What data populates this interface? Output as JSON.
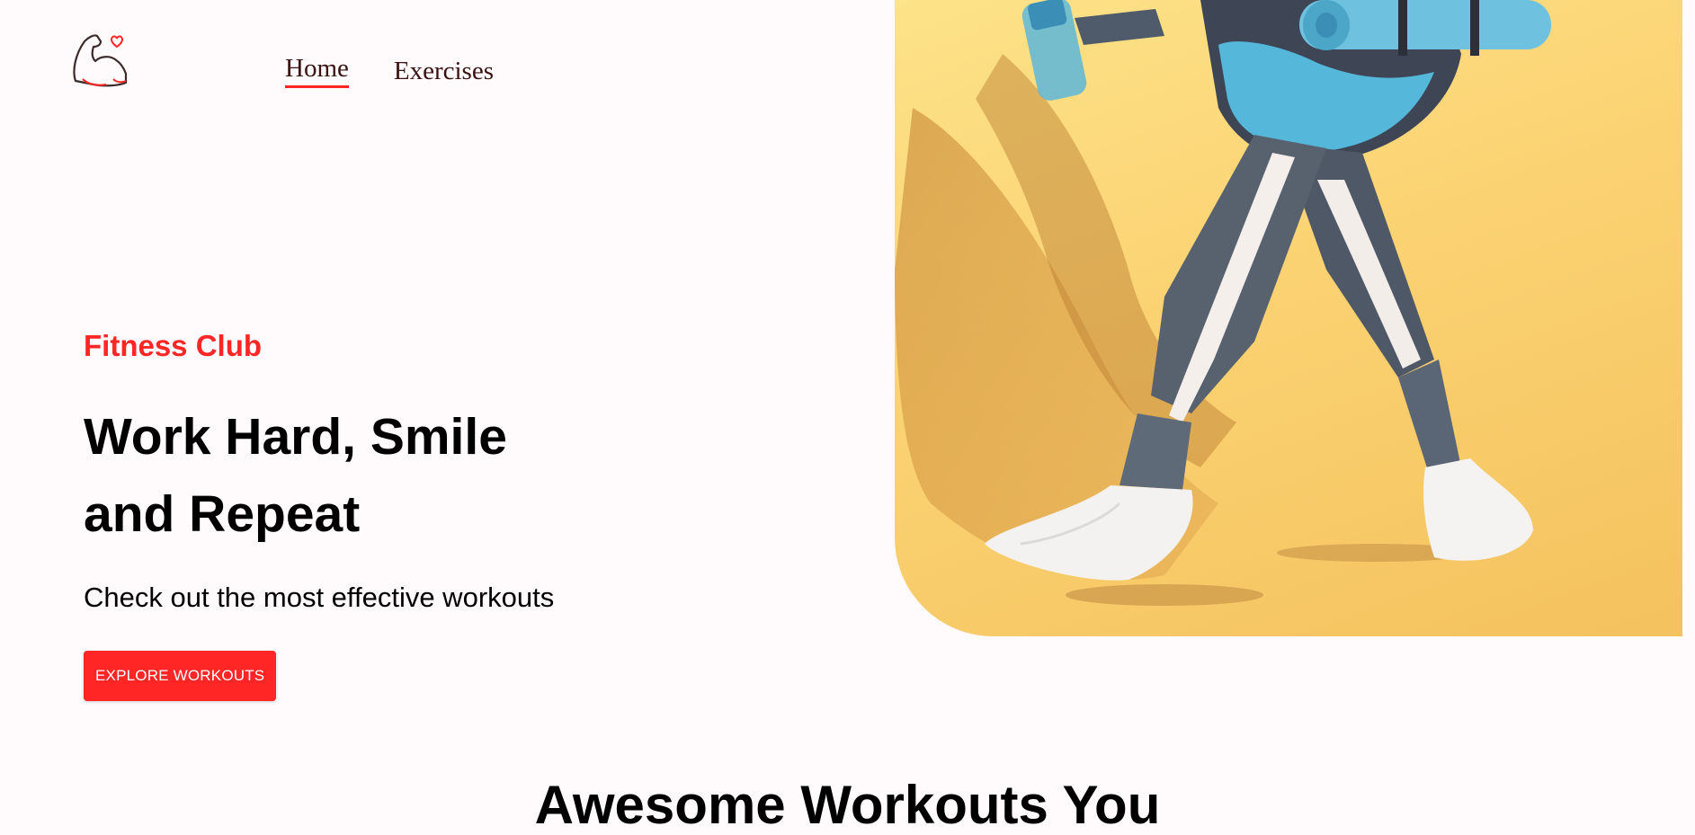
{
  "nav": {
    "logo_icon": "flexed-bicep-heart-icon",
    "links": [
      {
        "label": "Home",
        "active": true
      },
      {
        "label": "Exercises",
        "active": false
      }
    ]
  },
  "hero": {
    "tagline": "Fitness Club",
    "title": "Work Hard, Smile and Repeat",
    "subtitle": "Check out the most effective workouts",
    "button_label": "EXPLORE WORKOUTS"
  },
  "banner": {
    "image": "woman-walking-with-yoga-mat-and-bottle-photo"
  },
  "section": {
    "heading": "Awesome Workouts You"
  },
  "colors": {
    "accent": "#FF2625",
    "background": "#FFFAFB",
    "banner_bg": "#FBD272"
  }
}
